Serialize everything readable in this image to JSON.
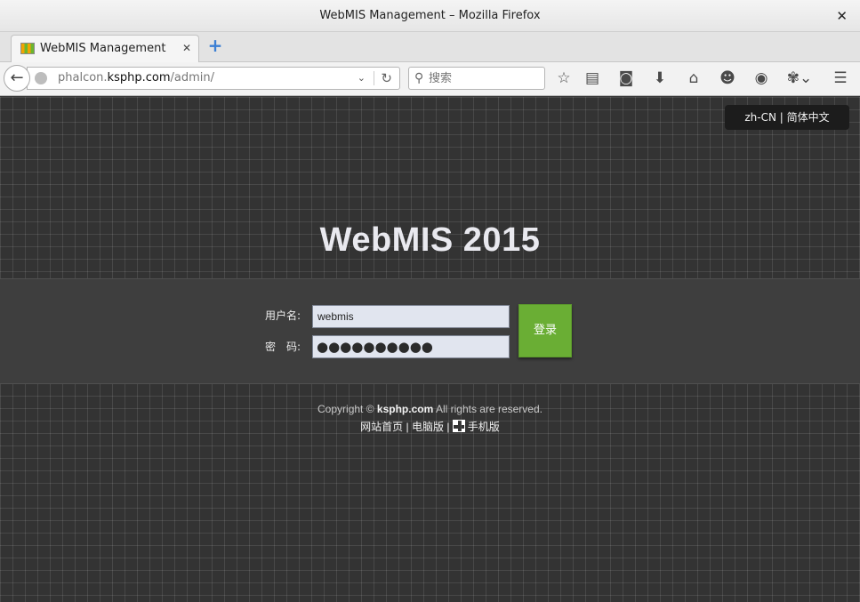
{
  "window": {
    "title": "WebMIS Management – Mozilla Firefox"
  },
  "tabs": [
    {
      "title": "WebMIS Management"
    }
  ],
  "navbar": {
    "url_prefix": "phalcon.",
    "url_host": "ksphp.com",
    "url_path": "/admin/",
    "search_placeholder": "搜索"
  },
  "toolbar_icons": [
    "bookmark-star-icon",
    "reading-list-icon",
    "pocket-icon",
    "download-icon",
    "home-icon",
    "chat-icon",
    "globe-addon-icon",
    "extension-icon",
    "menu-icon"
  ],
  "page": {
    "lang_code": "zh-CN",
    "lang_separator": " | ",
    "lang_name": "简体中文",
    "title": "WebMIS 2015",
    "login": {
      "username_label": "用户名:",
      "username_value": "webmis",
      "password_label": "密　码:",
      "password_mask": "●●●●●●●●●●",
      "submit_label": "登录"
    },
    "footer": {
      "copyright_prefix": "Copyright ©",
      "copyright_brand": "ksphp.com",
      "copyright_suffix": "All rights are reserved.",
      "link_home": "网站首页",
      "link_desktop": "电脑版",
      "link_mobile": "手机版",
      "separator": " | "
    }
  }
}
